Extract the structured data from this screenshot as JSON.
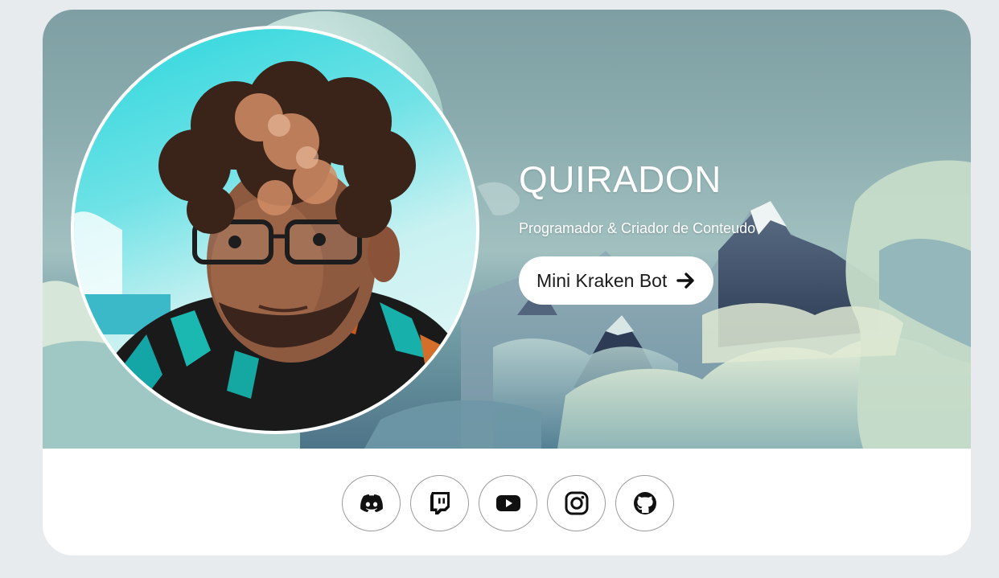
{
  "profile": {
    "name": "QUIRADON",
    "tagline": "Programador & Criador de Conteudo",
    "cta_label": "Mini Kraken Bot"
  },
  "icons": {
    "cta": "arrow-right-icon",
    "avatar": "profile-photo"
  },
  "socials": [
    {
      "name": "discord",
      "icon": "discord-icon"
    },
    {
      "name": "twitch",
      "icon": "twitch-icon"
    },
    {
      "name": "youtube",
      "icon": "youtube-icon"
    },
    {
      "name": "instagram",
      "icon": "instagram-icon"
    },
    {
      "name": "github",
      "icon": "github-icon"
    }
  ],
  "colors": {
    "page_background": "#e8ebee",
    "card_background": "#ffffff",
    "text_on_hero": "#ffffff",
    "button_background": "#ffffff",
    "button_text": "#1b1b1b"
  }
}
